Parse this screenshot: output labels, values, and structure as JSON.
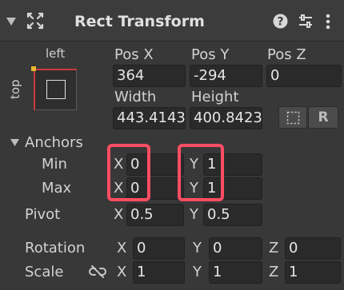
{
  "component": {
    "title": "Rect Transform",
    "icons": [
      "foldout-arrow-icon",
      "move-tool-icon",
      "help-icon",
      "presets-icon",
      "more-options-icon"
    ]
  },
  "anchor_preset": {
    "horizontal_label": "left",
    "vertical_label": "top"
  },
  "position": {
    "pos_x": {
      "label": "Pos X",
      "value": "364"
    },
    "pos_y": {
      "label": "Pos Y",
      "value": "-294"
    },
    "pos_z": {
      "label": "Pos Z",
      "value": "0"
    }
  },
  "size": {
    "width": {
      "label": "Width",
      "value": "443.4143"
    },
    "height": {
      "label": "Height",
      "value": "400.8423"
    },
    "blueprint_button": "",
    "raw_edit_button": "R"
  },
  "anchors": {
    "label": "Anchors",
    "min": {
      "label": "Min",
      "x_axis": "X",
      "x": "0",
      "y_axis": "Y",
      "y": "1"
    },
    "max": {
      "label": "Max",
      "x_axis": "X",
      "x": "0",
      "y_axis": "Y",
      "y": "1"
    }
  },
  "pivot": {
    "label": "Pivot",
    "x_axis": "X",
    "x": "0.5",
    "y_axis": "Y",
    "y": "0.5"
  },
  "rotation": {
    "label": "Rotation",
    "x_axis": "X",
    "x": "0",
    "y_axis": "Y",
    "y": "0",
    "z_axis": "Z",
    "z": "0"
  },
  "scale": {
    "label": "Scale",
    "x_axis": "X",
    "x": "1",
    "y_axis": "Y",
    "y": "1",
    "z_axis": "Z",
    "z": "1"
  },
  "colors": {
    "highlight": "#ff4d63",
    "panel": "#383838",
    "field": "#2a2a2a",
    "anchor_dot": "#e8b830"
  }
}
